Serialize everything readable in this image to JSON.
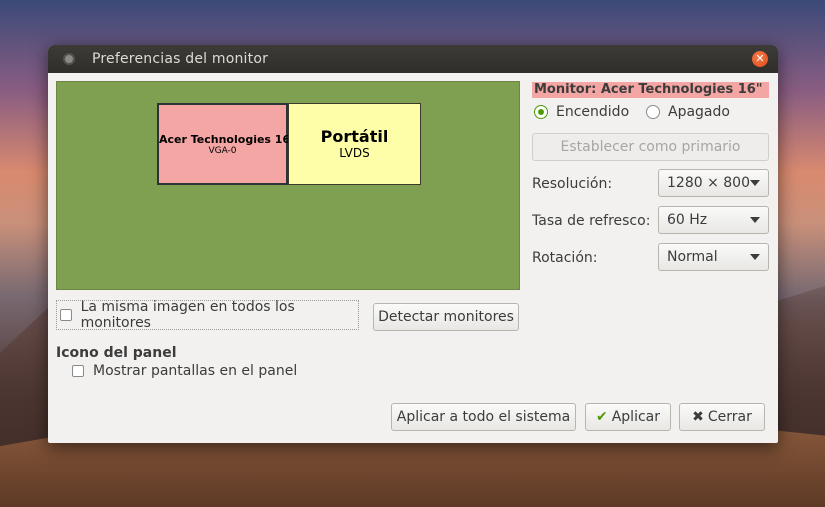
{
  "window": {
    "title": "Preferencias del monitor"
  },
  "preview": {
    "monitors": [
      {
        "name": "Acer Technologies 16\"",
        "sub": "VGA-0"
      },
      {
        "name": "Portátil",
        "sub": "LVDS"
      }
    ]
  },
  "options": {
    "mirror_label": "La misma imagen en todos los monitores",
    "detect_label": "Detectar monitores",
    "panel_heading": "Icono del panel",
    "panel_checkbox_label": "Mostrar pantallas en el panel"
  },
  "monitor": {
    "title": "Monitor: Acer Technologies 16\"",
    "on_label": "Encendido",
    "off_label": "Apagado",
    "on_selected": true,
    "primary_label": "Establecer como primario",
    "resolution_label": "Resolución:",
    "resolution_value": "1280 × 800",
    "refresh_label": "Tasa de refresco:",
    "refresh_value": "60 Hz",
    "rotation_label": "Rotación:",
    "rotation_value": "Normal"
  },
  "footer": {
    "apply_system_label": "Aplicar a todo el sistema",
    "apply_label": "Aplicar",
    "close_label": "Cerrar"
  },
  "colors": {
    "preview_bg": "#7f9f51",
    "acer_monitor": "#f4a6a4",
    "laptop_monitor": "#fffea8",
    "accent_green": "#4e9a06",
    "close_orange": "#df4b16"
  }
}
